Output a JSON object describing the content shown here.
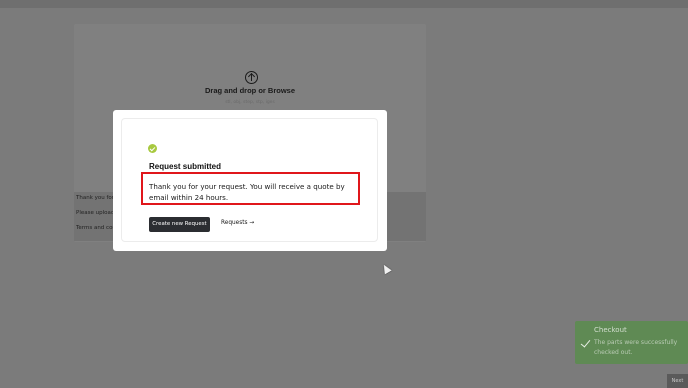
{
  "background": {
    "upload": {
      "title": "Drag and drop or Browse",
      "formats": "stl, obj, step, stp, iges"
    },
    "info_lines": [
      "Thank you for y",
      "Please upload",
      "Terms and con"
    ],
    "next_button": "Next"
  },
  "modal": {
    "title": "Request submitted",
    "message": "Thank you for your request. You will receive a quote by email within 24 hours.",
    "create_button": "Create new Request",
    "requests_link": "Requests →"
  },
  "toast": {
    "title": "Checkout",
    "message": "The parts were successfully checked out."
  },
  "colors": {
    "overlay": "#7b7b7b",
    "success_icon": "#a8c940",
    "highlight_border": "#e0161b",
    "primary_button": "#2b2d31",
    "toast": "#5f8a54"
  }
}
